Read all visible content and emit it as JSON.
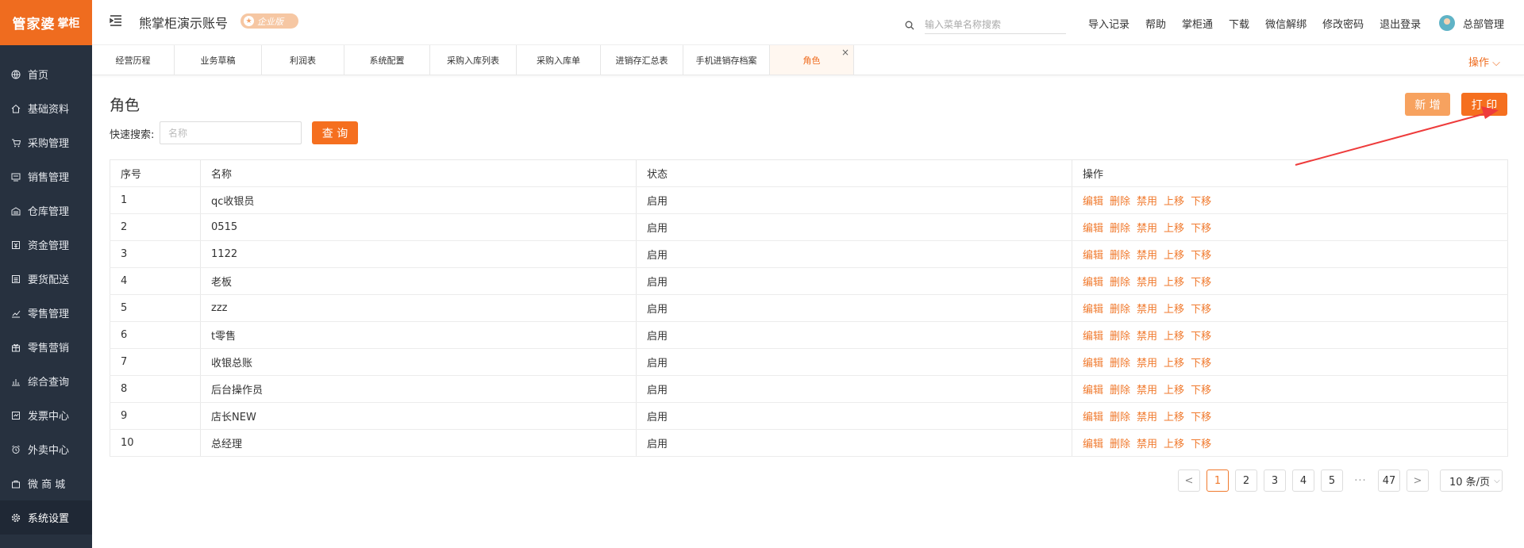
{
  "sidebar": {
    "logo_main": "管家婆",
    "logo_sub": "掌柜",
    "items": [
      {
        "label": "首页",
        "icon": "globe-icon"
      },
      {
        "label": "基础资料",
        "icon": "home-icon"
      },
      {
        "label": "采购管理",
        "icon": "cart-icon"
      },
      {
        "label": "销售管理",
        "icon": "screen-icon"
      },
      {
        "label": "仓库管理",
        "icon": "warehouse-icon"
      },
      {
        "label": "资金管理",
        "icon": "money-icon"
      },
      {
        "label": "要货配送",
        "icon": "list-icon"
      },
      {
        "label": "零售管理",
        "icon": "chart-icon"
      },
      {
        "label": "零售营销",
        "icon": "gift-icon"
      },
      {
        "label": "综合查询",
        "icon": "bar-chart-icon"
      },
      {
        "label": "发票中心",
        "icon": "invoice-icon"
      },
      {
        "label": "外卖中心",
        "icon": "alarm-icon"
      },
      {
        "label": "微 商 城",
        "icon": "bag-icon"
      },
      {
        "label": "系统设置",
        "icon": "gear-icon"
      }
    ],
    "active_index": 13
  },
  "header": {
    "account": "熊掌柜演示账号",
    "edition_badge": "企业版",
    "search_placeholder": "输入菜单名称搜索",
    "links": [
      "导入记录",
      "帮助",
      "掌柜通",
      "下载",
      "微信解绑",
      "修改密码",
      "退出登录"
    ],
    "user": "总部管理"
  },
  "tabs": {
    "items": [
      "经营历程",
      "业务草稿",
      "利润表",
      "系统配置",
      "采购入库列表",
      "采购入库单",
      "进销存汇总表",
      "手机进销存档案",
      "角色"
    ],
    "active_index": 8,
    "close_glyph": "×",
    "ops_label": "操作 ⌵"
  },
  "page": {
    "title": "角色",
    "quick_search_label": "快速搜索:",
    "quick_search_placeholder": "名称",
    "query_button": "查 询",
    "add_button": "新 增",
    "print_button": "打 印"
  },
  "table": {
    "headers": [
      "序号",
      "名称",
      "状态",
      "操作"
    ],
    "rows": [
      {
        "no": "1",
        "name": "qc收银员",
        "status": "启用"
      },
      {
        "no": "2",
        "name": "0515",
        "status": "启用"
      },
      {
        "no": "3",
        "name": "1122",
        "status": "启用"
      },
      {
        "no": "4",
        "name": "老板",
        "status": "启用"
      },
      {
        "no": "5",
        "name": "zzz",
        "status": "启用"
      },
      {
        "no": "6",
        "name": "t零售",
        "status": "启用"
      },
      {
        "no": "7",
        "name": "收银总账",
        "status": "启用"
      },
      {
        "no": "8",
        "name": "后台操作员",
        "status": "启用"
      },
      {
        "no": "9",
        "name": "店长NEW",
        "status": "启用"
      },
      {
        "no": "10",
        "name": "总经理",
        "status": "启用"
      }
    ],
    "actions": [
      "编辑",
      "删除",
      "禁用",
      "上移",
      "下移"
    ]
  },
  "pagination": {
    "prev": "<",
    "pages": [
      "1",
      "2",
      "3",
      "4",
      "5"
    ],
    "current": "1",
    "ellipsis": "···",
    "last": "47",
    "next": ">",
    "page_size": "10 条/页"
  },
  "colors": {
    "accent": "#f56f1f",
    "accent_light": "#f7a25f",
    "sidebar_bg": "#27313f",
    "link": "#f07a2e",
    "annotation_arrow": "#ee3b3b"
  }
}
